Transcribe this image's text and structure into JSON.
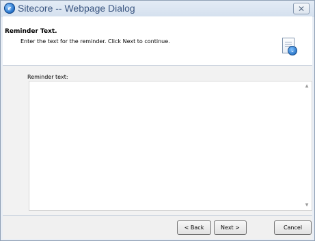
{
  "window": {
    "title": "Sitecore -- Webpage Dialog",
    "close_glyph": "✕"
  },
  "header": {
    "title": "Reminder Text.",
    "description": "Enter the text for the reminder. Click Next to continue."
  },
  "form": {
    "reminder_label": "Reminder text:",
    "reminder_value": ""
  },
  "buttons": {
    "back": "< Back",
    "next": "Next >",
    "cancel": "Cancel"
  },
  "icons": {
    "app": "internet-explorer-icon",
    "header": "document-icon"
  }
}
